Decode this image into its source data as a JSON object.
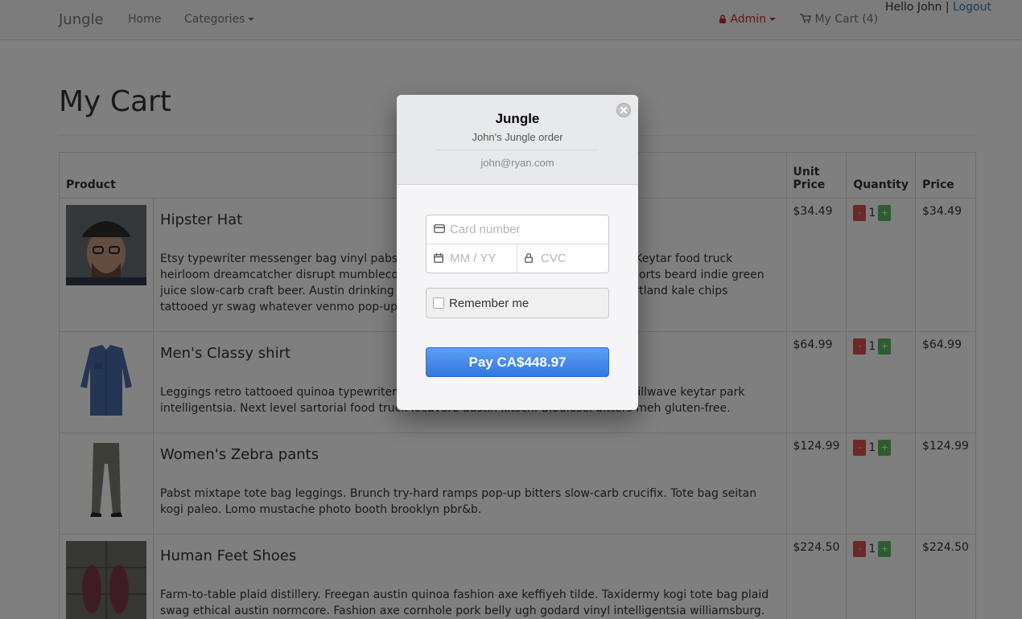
{
  "navbar": {
    "brand": "Jungle",
    "home": "Home",
    "categories": "Categories",
    "admin": "Admin",
    "cart": "My Cart (4)",
    "greeting": "Hello John |",
    "logout": "Logout"
  },
  "page": {
    "title": "My Cart"
  },
  "table": {
    "headers": {
      "product": "Product",
      "unit_price_1": "Unit",
      "unit_price_2": "Price",
      "quantity": "Quantity",
      "price": "Price"
    },
    "rows": [
      {
        "name": "Hipster Hat",
        "description": "Etsy typewriter messenger bag vinyl pabst cold-pressed fixie church-key slow-carb. Keytar food truck heirloom dreamcatcher disrupt mumblecore. Butcher cold-pressed scenester jean shorts beard indie green juice slow-carb craft beer. Austin drinking intelligentsia waistcoat normcore. Wolf portland kale chips tattooed yr swag whatever venmo pop-up irony slow-carb.",
        "unit_price": "$34.49",
        "qty": "1",
        "price": "$34.49"
      },
      {
        "name": "Men's Classy shirt",
        "description": "Leggings retro tattooed quinoa typewriter blog fingerstache shoreditch pork belly chillwave keytar park intelligentsia. Next level sartorial food truck locavore austin kitsch. Biodiesel bitters meh gluten-free.",
        "unit_price": "$64.99",
        "qty": "1",
        "price": "$64.99"
      },
      {
        "name": "Women's Zebra pants",
        "description": "Pabst mixtape tote bag leggings. Brunch try-hard ramps pop-up bitters slow-carb crucifix. Tote bag seitan kogi paleo. Lomo mustache photo booth brooklyn pbr&b.",
        "unit_price": "$124.99",
        "qty": "1",
        "price": "$124.99"
      },
      {
        "name": "Human Feet Shoes",
        "description": "Farm-to-table plaid distillery. Freegan austin quinoa fashion axe keffiyeh tilde. Taxidermy kogi tote bag plaid swag ethical austin normcore. Fashion axe cornhole pork belly ugh godard vinyl intelligentsia williamsburg. Mlkshk pinterest",
        "unit_price": "$224.50",
        "qty": "1",
        "price": "$224.50"
      }
    ],
    "minus": "-",
    "plus": "+"
  },
  "modal": {
    "title": "Jungle",
    "subtitle": "John's Jungle order",
    "email": "john@ryan.com",
    "card_number_placeholder": "Card number",
    "expiry_placeholder": "MM / YY",
    "cvc_placeholder": "CVC",
    "remember_label": "Remember me",
    "pay_label": "Pay CA$448.97"
  }
}
